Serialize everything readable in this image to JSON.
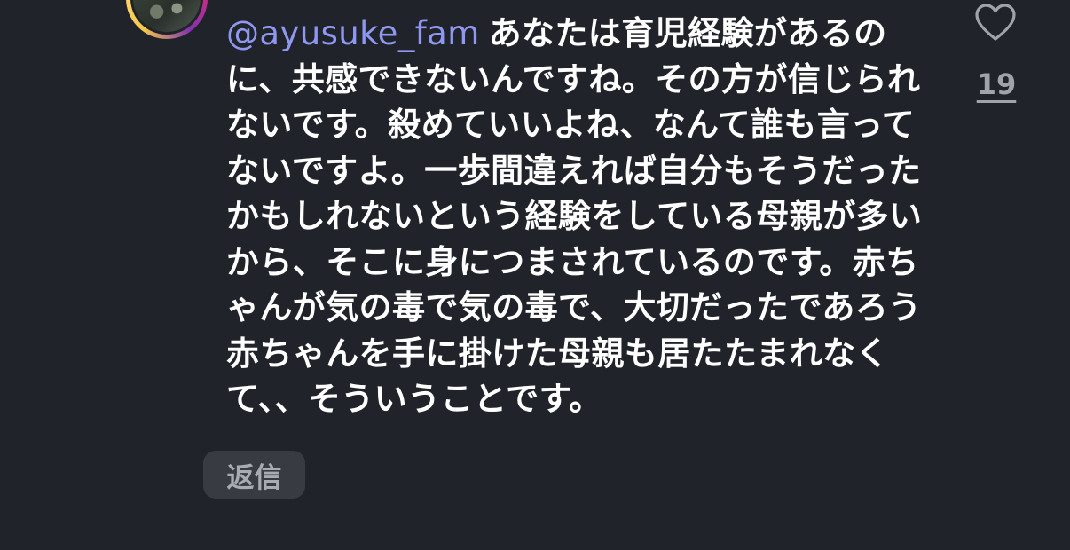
{
  "comment": {
    "mention": "@ayusuke_fam",
    "text": "あなたは育児経験があるのに、共感できないんですね。その方が信じられないです。殺めていいよね、なんて誰も言ってないですよ。一歩間違えれば自分もそうだったかもしれないという経験をしている母親が多いから、そこに身につまされているのです。赤ちゃんが気の毒で気の毒で、大切だったであろう赤ちゃんを手に掛けた母親も居たたまれなくて、、そういうことです。",
    "reply_label": "返信"
  },
  "like": {
    "icon": "heart-icon",
    "count": "19"
  },
  "colors": {
    "background": "#21232a",
    "mention": "#8f98f0",
    "reply_bg": "#393b43"
  }
}
